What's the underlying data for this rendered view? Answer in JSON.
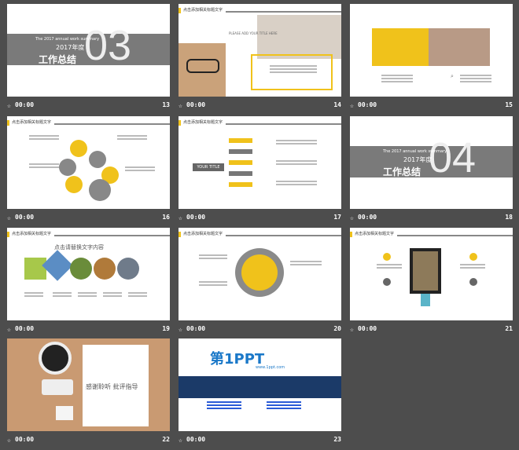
{
  "slides": [
    {
      "duration": "00:00",
      "number": "13",
      "section_number": "03",
      "year": "2017年度",
      "title": "工作总结",
      "subtitle": "The 2017 annual work summary"
    },
    {
      "duration": "00:00",
      "number": "14",
      "header": "点击添加相关标题文字",
      "caption": "PLEASE ADD YOUR TITLE HERE"
    },
    {
      "duration": "00:00",
      "number": "15"
    },
    {
      "duration": "00:00",
      "number": "16",
      "header": "点击添加相关标题文字"
    },
    {
      "duration": "00:00",
      "number": "17",
      "header": "点击添加相关标题文字",
      "label": "YOUR TITLE"
    },
    {
      "duration": "00:00",
      "number": "18",
      "section_number": "04",
      "year": "2017年度",
      "title": "工作总结",
      "subtitle": "The 2017 annual work summary"
    },
    {
      "duration": "00:00",
      "number": "19",
      "header": "点击添加相关标题文字",
      "headline": "点击请替换文字内容"
    },
    {
      "duration": "00:00",
      "number": "20",
      "header": "点击添加相关标题文字"
    },
    {
      "duration": "00:00",
      "number": "21",
      "header": "点击添加相关标题文字"
    },
    {
      "duration": "00:00",
      "number": "22",
      "thanks": "感谢聆听 批评指导"
    },
    {
      "duration": "00:00",
      "number": "23",
      "logo": "第1PPT",
      "logo_url": "www.1ppt.com"
    }
  ],
  "colors": {
    "accent": "#f0c21b",
    "gray": "#7a7a7a",
    "background": "#4d4d4d"
  },
  "icons": [
    "star-icon"
  ]
}
